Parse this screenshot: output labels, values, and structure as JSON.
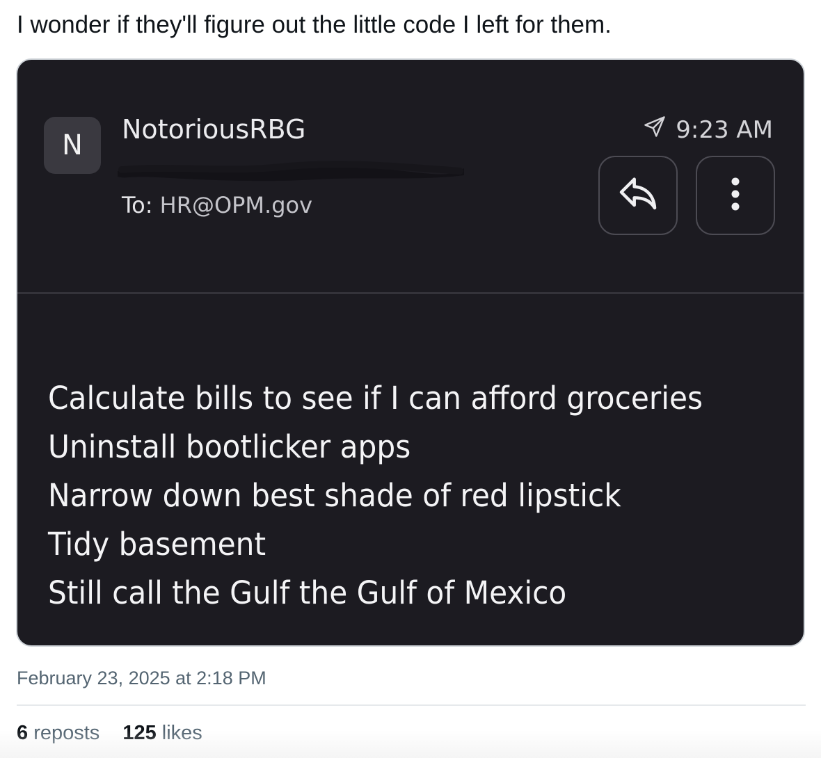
{
  "post": {
    "text": "I wonder if they'll figure out the little code I left for them.",
    "date": "February 23, 2025 at 2:18 PM",
    "reposts_count": "6",
    "reposts_label": "reposts",
    "likes_count": "125",
    "likes_label": "likes"
  },
  "email": {
    "avatar_letter": "N",
    "sender_name": "NotoriousRBG",
    "to_label": "To:",
    "to_address": "HR@OPM.gov",
    "time": "9:23 AM",
    "icons": {
      "sent": "paper-plane-icon",
      "reply": "reply-arrow-icon",
      "more": "vertical-dots-icon"
    },
    "body_lines": [
      "Calculate bills to see if I can afford groceries",
      "Uninstall bootlicker apps",
      "Narrow down best shade of red lipstick",
      "Tidy basement",
      "Still call the Gulf the Gulf of Mexico"
    ]
  },
  "colors": {
    "card_background": "#1c1b21",
    "card_border": "#cfd4d9",
    "secondary_text": "#536471",
    "primary_text": "#0f1419"
  }
}
